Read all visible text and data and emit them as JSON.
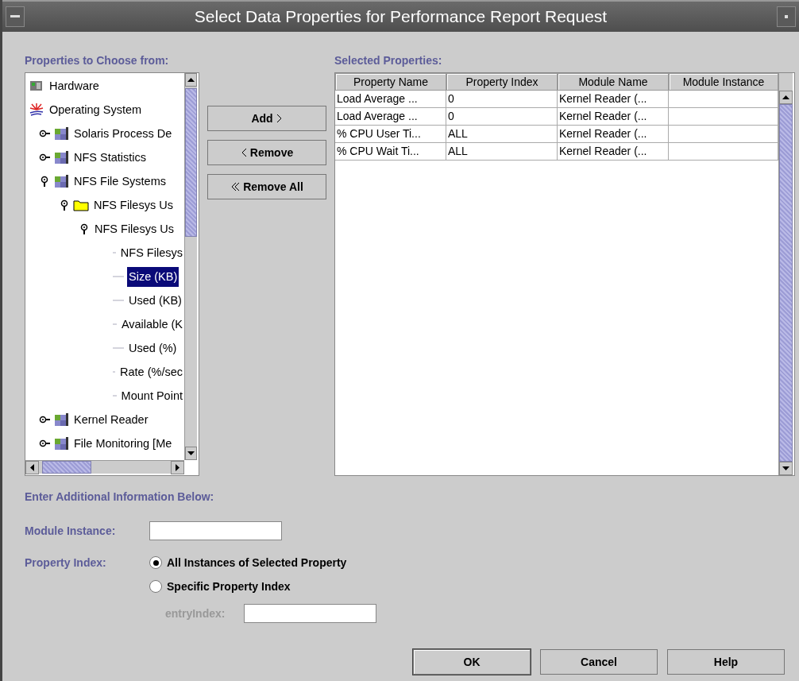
{
  "window": {
    "title": "Select Data Properties for Performance Report Request"
  },
  "tree": {
    "label": "Properties to Choose from:",
    "items": [
      {
        "label": "Hardware",
        "kind": "hardware",
        "selected": false
      },
      {
        "label": "Operating System",
        "kind": "os",
        "selected": false,
        "children": [
          {
            "label": "Solaris Process De",
            "kind": "module",
            "expanded": false,
            "selected": false
          },
          {
            "label": "NFS Statistics",
            "kind": "module",
            "expanded": false,
            "selected": false
          },
          {
            "label": "NFS File Systems",
            "kind": "module",
            "expanded": true,
            "selected": false,
            "children": [
              {
                "label": "NFS Filesys Us",
                "kind": "folder",
                "expanded": true,
                "selected": false,
                "children": [
                  {
                    "label": "NFS Filesys Us",
                    "expanded": true,
                    "selected": false,
                    "children": [
                      {
                        "label": "NFS Filesys",
                        "kind": "leaf",
                        "selected": false
                      },
                      {
                        "label": "Size (KB)",
                        "kind": "leaf",
                        "selected": true
                      },
                      {
                        "label": "Used (KB)",
                        "kind": "leaf",
                        "selected": false
                      },
                      {
                        "label": "Available (K",
                        "kind": "leaf",
                        "selected": false
                      },
                      {
                        "label": "Used (%)",
                        "kind": "leaf",
                        "selected": false
                      },
                      {
                        "label": "Rate (%/sec",
                        "kind": "leaf",
                        "selected": false
                      },
                      {
                        "label": "Mount Point",
                        "kind": "leaf",
                        "selected": false
                      }
                    ]
                  }
                ]
              }
            ]
          },
          {
            "label": "Kernel Reader",
            "kind": "module",
            "expanded": false,
            "selected": false
          },
          {
            "label": "File Monitoring [Me",
            "kind": "module",
            "expanded": false,
            "selected": false
          }
        ]
      }
    ]
  },
  "move_buttons": [
    {
      "label": "Add",
      "kind": "add"
    },
    {
      "label": "Remove",
      "kind": "remove"
    },
    {
      "label": "Remove All",
      "kind": "remove_all"
    }
  ],
  "table": {
    "label": "Selected Properties:",
    "columns": [
      "Property Name",
      "Property Index",
      "Module Name",
      "Module Instance"
    ],
    "rows": [
      [
        "Load Average ...",
        "0",
        "Kernel Reader (..."
      ],
      [
        "Load Average ...",
        "0",
        "Kernel Reader (..."
      ],
      [
        "% CPU User Ti...",
        "ALL",
        "Kernel Reader (..."
      ],
      [
        "% CPU Wait Ti...",
        "ALL",
        "Kernel Reader (..."
      ]
    ]
  },
  "additional": {
    "heading": "Enter Additional Information Below:",
    "module_instance_label": "Module Instance:",
    "property_index_label": "Property Index:",
    "options": [
      {
        "label": "All Instances of Selected Property",
        "selected": true
      },
      {
        "label": "Specific Property Index",
        "selected": false
      }
    ],
    "entry_index": {
      "label": "entryIndex:",
      "disabled": true
    }
  },
  "buttons": [
    {
      "label": "OK",
      "default": true
    },
    {
      "label": "Cancel",
      "default": false
    },
    {
      "label": "Help",
      "default": false
    }
  ]
}
